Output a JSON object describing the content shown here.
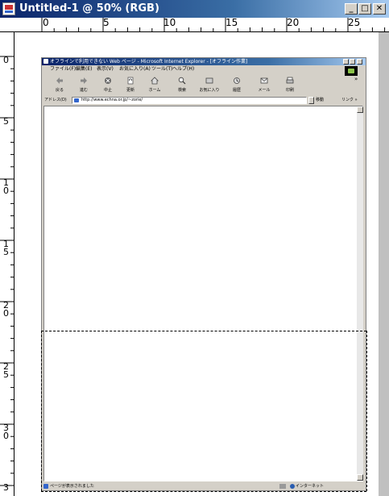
{
  "window": {
    "title": "Untitled-1 @ 50% (RGB)",
    "minimize_glyph": "_",
    "maximize_glyph": "□",
    "close_glyph": "✕"
  },
  "ruler": {
    "horizontal": [
      "0",
      "5",
      "10",
      "15",
      "20",
      "25"
    ],
    "vertical": [
      "0",
      "5",
      "10",
      "15",
      "20",
      "25",
      "30",
      "3"
    ]
  },
  "ie": {
    "title": "オフラインで利用できない Web ページ - Microsoft Internet Explorer - [オフライン作業]",
    "menu": [
      "ファイル(F)",
      "編集(E)",
      "表示(V)",
      "お気に入り(A)",
      "ツール(T)",
      "ヘルプ(H)"
    ],
    "toolbar": [
      {
        "label": "戻る",
        "icon": "back-arrow-icon"
      },
      {
        "label": "進む",
        "icon": "forward-arrow-icon"
      },
      {
        "label": "中止",
        "icon": "stop-icon"
      },
      {
        "label": "更新",
        "icon": "refresh-icon"
      },
      {
        "label": "ホーム",
        "icon": "home-icon"
      },
      {
        "label": "検索",
        "icon": "search-icon"
      },
      {
        "label": "お気に入り",
        "icon": "favorites-icon"
      },
      {
        "label": "履歴",
        "icon": "history-icon"
      },
      {
        "label": "メール",
        "icon": "mail-icon"
      },
      {
        "label": "印刷",
        "icon": "print-icon"
      }
    ],
    "toolbar_more": "»",
    "address_label": "アドレス(D)",
    "address_value": "http://www.echna.or.jp/~zorie/",
    "go_label": "移動",
    "links_label": "リンク »",
    "status_text": "ページが表示されました",
    "status_zone": "インターネット"
  },
  "colors": {
    "title_gradient_start": "#0a246a",
    "title_gradient_end": "#a6caf0",
    "chrome": "#d4d0c8"
  }
}
